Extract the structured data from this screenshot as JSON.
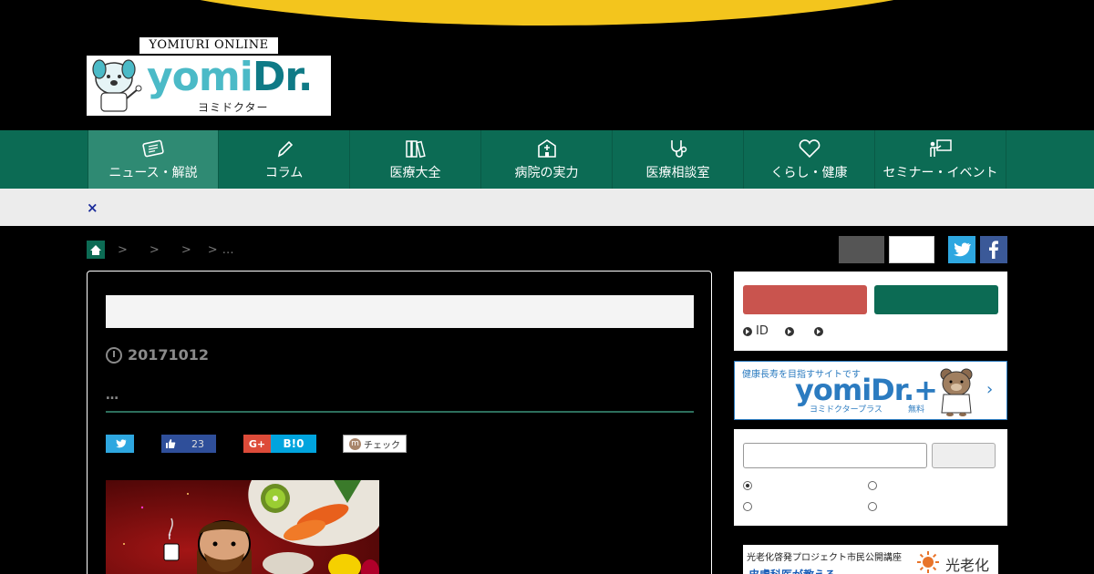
{
  "logo": {
    "top_text": "YOMIURI ONLINE",
    "main_part1": "yomi",
    "main_part2": "Dr.",
    "sub": "ヨミドクター"
  },
  "nav": {
    "items": [
      {
        "label": "ニュース・解説",
        "icon": "newspaper-icon"
      },
      {
        "label": "コラム",
        "icon": "pencil-icon"
      },
      {
        "label": "医療大全",
        "icon": "books-icon"
      },
      {
        "label": "病院の実力",
        "icon": "hospital-icon"
      },
      {
        "label": "医療相談室",
        "icon": "stethoscope-icon"
      },
      {
        "label": "くらし・健康",
        "icon": "heart-icon"
      },
      {
        "label": "セミナー・イベント",
        "icon": "presentation-icon"
      }
    ]
  },
  "strip": {
    "close_label": "×"
  },
  "breadcrumb": {
    "sep1": ">",
    "sep2": ">",
    "sep3": ">",
    "sep4": ">",
    "tail": "…"
  },
  "article": {
    "date": "20171012",
    "ellipsis": "…",
    "share": {
      "like_count": "23",
      "gplus": "G+",
      "hatena": "B!0",
      "check": "チェック",
      "check_badge": "m"
    }
  },
  "sidebar": {
    "login_links": [
      "ID",
      "",
      ""
    ],
    "banner": {
      "tagline": "健康長寿を目指すサイトです",
      "name": "yomiDr.+",
      "sub": "ヨミドクタープラス",
      "free": "無料",
      "arrow": "›"
    },
    "ad": {
      "line1": "光老化啓発プロジェクト市民公開講座",
      "line2": "皮膚科医が教える",
      "brand": "光老化"
    }
  },
  "colors": {
    "accent_yellow": "#f3c51d",
    "nav_green": "#0c6b54",
    "login_red": "#c9544e",
    "twitter": "#2ea7e0",
    "facebook": "#3b5998"
  }
}
